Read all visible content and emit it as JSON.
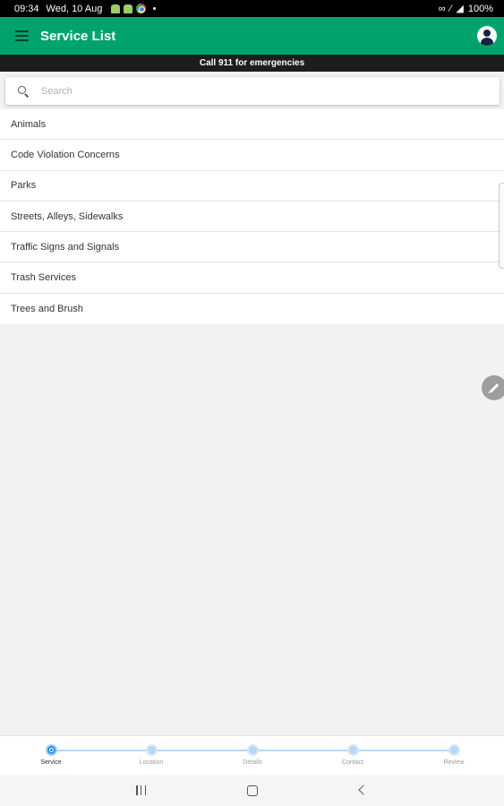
{
  "status_bar": {
    "time": "09:34",
    "date": "Wed, 10 Aug",
    "battery": "100%"
  },
  "app_bar": {
    "title": "Service List",
    "color": "#00a36c"
  },
  "banner": {
    "text": "Call 911 for emergencies"
  },
  "search": {
    "placeholder": "Search",
    "value": ""
  },
  "services": [
    "Animals",
    "Code Violation Concerns",
    "Parks",
    "Streets, Alleys, Sidewalks",
    "Traffic Signs and Signals",
    "Trash Services",
    "Trees and Brush"
  ],
  "stepper": {
    "active": "Service",
    "steps": [
      "Service",
      "Location",
      "Details",
      "Contact",
      "Review"
    ]
  }
}
